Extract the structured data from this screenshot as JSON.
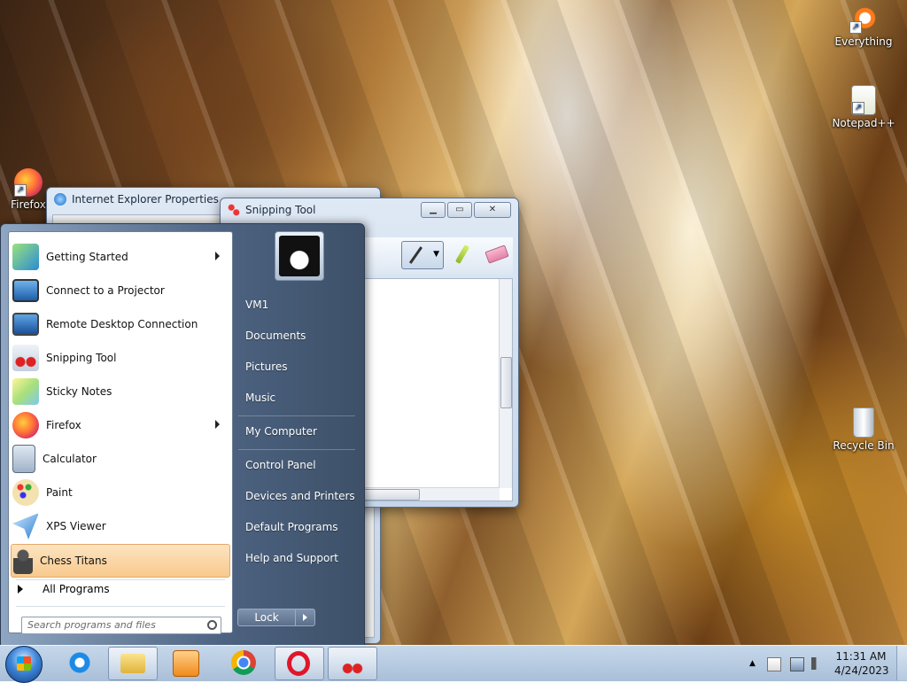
{
  "desktop_icons": [
    {
      "id": "everything",
      "label": "Everything",
      "icon": "everything-icon"
    },
    {
      "id": "notepadpp",
      "label": "Notepad++",
      "icon": "notepad-plus-plus-icon"
    },
    {
      "id": "firefox",
      "label": "Firefox",
      "icon": "firefox-icon"
    },
    {
      "id": "recycle",
      "label": "Recycle Bin",
      "icon": "recycle-bin-icon"
    }
  ],
  "windows": {
    "ie_properties": {
      "title": "Internet Explorer Properties"
    },
    "snipping_tool": {
      "title": "Snipping Tool"
    }
  },
  "start_menu": {
    "programs": [
      {
        "label": "Getting Started",
        "icon": "getting-started-icon",
        "submenu": true
      },
      {
        "label": "Connect to a Projector",
        "icon": "projector-icon",
        "submenu": false
      },
      {
        "label": "Remote Desktop Connection",
        "icon": "remote-desktop-icon",
        "submenu": false
      },
      {
        "label": "Snipping Tool",
        "icon": "snipping-tool-icon",
        "submenu": false
      },
      {
        "label": "Sticky Notes",
        "icon": "sticky-notes-icon",
        "submenu": false
      },
      {
        "label": "Firefox",
        "icon": "firefox-icon",
        "submenu": true
      },
      {
        "label": "Calculator",
        "icon": "calculator-icon",
        "submenu": false
      },
      {
        "label": "Paint",
        "icon": "paint-icon",
        "submenu": false
      },
      {
        "label": "XPS Viewer",
        "icon": "xps-viewer-icon",
        "submenu": false
      },
      {
        "label": "Chess Titans",
        "icon": "chess-titans-icon",
        "submenu": false,
        "highlighted": true
      }
    ],
    "all_programs": "All Programs",
    "search_placeholder": "Search programs and files",
    "right_links": [
      "VM1",
      "Documents",
      "Pictures",
      "Music",
      "My Computer",
      "Control Panel",
      "Devices and Printers",
      "Default Programs",
      "Help and Support"
    ],
    "lock_label": "Lock"
  },
  "taskbar": {
    "pinned": [
      {
        "name": "internet-explorer",
        "icon": "internet-explorer-icon"
      },
      {
        "name": "file-explorer",
        "icon": "folder-icon"
      },
      {
        "name": "media-player",
        "icon": "media-player-icon"
      },
      {
        "name": "chrome",
        "icon": "chrome-icon"
      },
      {
        "name": "opera",
        "icon": "opera-icon"
      },
      {
        "name": "snipping-tool",
        "icon": "snipping-tool-icon"
      }
    ],
    "clock": {
      "time": "11:31 AM",
      "date": "4/24/2023"
    }
  },
  "colors": {
    "highlight": "#f8c98d",
    "start_panel": "#4c6280",
    "taskbar": "#b6c9de"
  }
}
